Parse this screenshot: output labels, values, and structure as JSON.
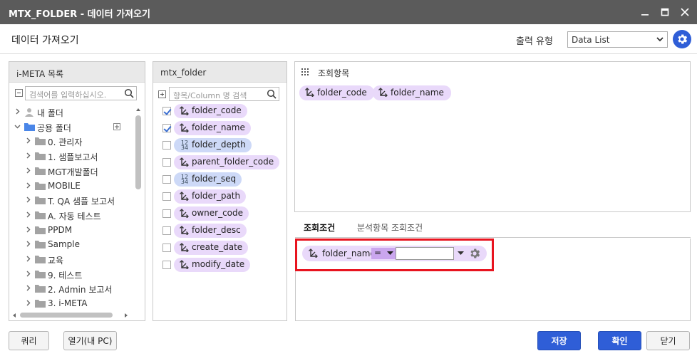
{
  "window": {
    "title": "MTX_FOLDER - 데이터 가져오기"
  },
  "header": {
    "title": "데이터 가져오기",
    "output_type_label": "출력 유형",
    "output_type_value": "Data List"
  },
  "meta_panel": {
    "title": "i-META 목록",
    "search_placeholder": "검색어를 입력하십시오.",
    "tree": [
      {
        "label": "내 폴더",
        "kind": "user",
        "expanded": false,
        "level": 0
      },
      {
        "label": "공용 폴더",
        "kind": "folder-blue",
        "expanded": true,
        "level": 0
      },
      {
        "label": "0. 관리자",
        "kind": "folder",
        "expanded": false,
        "level": 1
      },
      {
        "label": "1. 샘플보고서",
        "kind": "folder",
        "expanded": false,
        "level": 1
      },
      {
        "label": "MGT개발폴더",
        "kind": "folder",
        "expanded": false,
        "level": 1
      },
      {
        "label": "MOBILE",
        "kind": "folder",
        "expanded": false,
        "level": 1
      },
      {
        "label": "T. QA 샘플 보고서",
        "kind": "folder",
        "expanded": false,
        "level": 1
      },
      {
        "label": "A. 자동 테스트",
        "kind": "folder",
        "expanded": false,
        "level": 1
      },
      {
        "label": "PPDM",
        "kind": "folder",
        "expanded": false,
        "level": 1
      },
      {
        "label": "Sample",
        "kind": "folder",
        "expanded": false,
        "level": 1
      },
      {
        "label": "교육",
        "kind": "folder",
        "expanded": false,
        "level": 1
      },
      {
        "label": "9. 테스트",
        "kind": "folder",
        "expanded": false,
        "level": 1
      },
      {
        "label": "2. Admin 보고서",
        "kind": "folder",
        "expanded": false,
        "level": 1
      },
      {
        "label": "3. i-META",
        "kind": "folder",
        "expanded": false,
        "level": 1
      }
    ]
  },
  "field_panel": {
    "title": "mtx_folder",
    "search_placeholder": "항목/Column 명 검색",
    "fields": [
      {
        "name": "folder_code",
        "type": "dim",
        "checked": true
      },
      {
        "name": "folder_name",
        "type": "dim",
        "checked": true
      },
      {
        "name": "folder_depth",
        "type": "num",
        "checked": false
      },
      {
        "name": "parent_folder_code",
        "type": "dim",
        "checked": false
      },
      {
        "name": "folder_seq",
        "type": "num",
        "checked": false
      },
      {
        "name": "folder_path",
        "type": "dim",
        "checked": false
      },
      {
        "name": "owner_code",
        "type": "dim",
        "checked": false
      },
      {
        "name": "folder_desc",
        "type": "dim",
        "checked": false
      },
      {
        "name": "create_date",
        "type": "dim",
        "checked": false
      },
      {
        "name": "modify_date",
        "type": "dim",
        "checked": false
      }
    ]
  },
  "query_items": {
    "title": "조회항목",
    "items": [
      "folder_code",
      "folder_name"
    ]
  },
  "condition_tabs": [
    "조회조건",
    "분석항목 조회조건"
  ],
  "condition": {
    "field": "folder_name",
    "operator": "=",
    "value": ""
  },
  "footer": {
    "query_btn": "쿼리",
    "open_btn": "열기(내 PC)",
    "save_btn": "저장",
    "ok_btn": "확인",
    "close_btn": "닫기"
  }
}
